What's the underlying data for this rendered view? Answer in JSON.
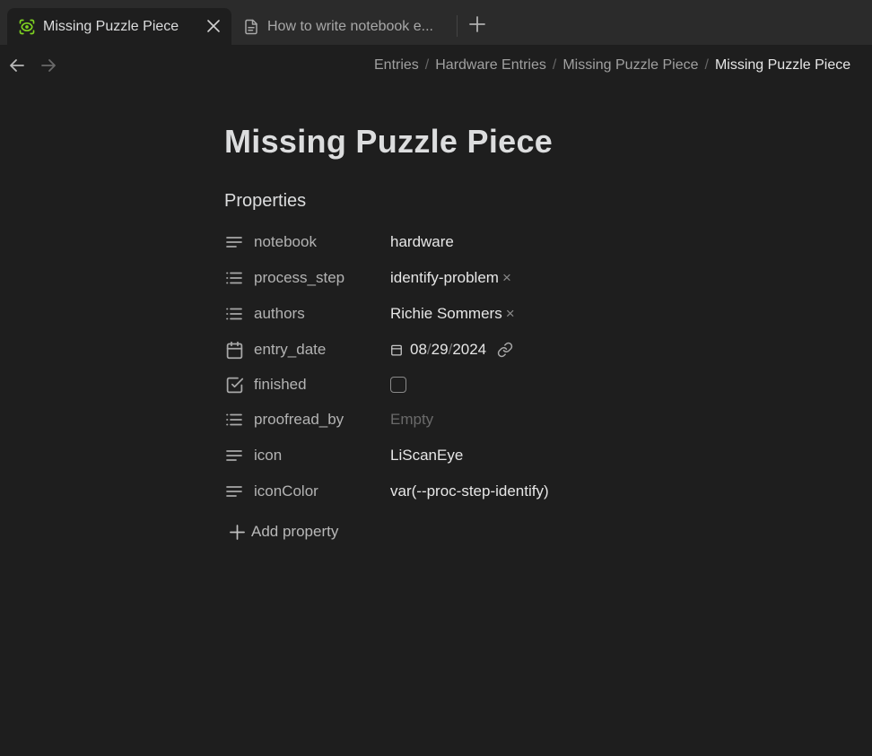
{
  "tabs": [
    {
      "title": "Missing Puzzle Piece",
      "active": true,
      "icon": "scan-eye-icon"
    },
    {
      "title": "How to write notebook e...",
      "active": false,
      "icon": "file-icon"
    }
  ],
  "breadcrumb": [
    "Entries",
    "Hardware Entries",
    "Missing Puzzle Piece",
    "Missing Puzzle Piece"
  ],
  "page": {
    "title": "Missing Puzzle Piece",
    "properties_heading": "Properties",
    "properties": [
      {
        "key": "notebook",
        "value": "hardware",
        "icon": "text-icon"
      },
      {
        "key": "process_step",
        "value": "identify-problem",
        "icon": "list-icon"
      },
      {
        "key": "authors",
        "value": "Richie Sommers",
        "icon": "list-icon"
      },
      {
        "key": "entry_date",
        "month": "08",
        "day": "29",
        "year": "2024",
        "icon": "calendar-icon"
      },
      {
        "key": "finished",
        "value": false,
        "icon": "checkbox-icon"
      },
      {
        "key": "proofread_by",
        "placeholder": "Empty",
        "icon": "list-icon"
      },
      {
        "key": "icon",
        "value": "LiScanEye",
        "icon": "text-icon"
      },
      {
        "key": "iconColor",
        "value": "var(--proc-step-identify)",
        "icon": "text-icon"
      }
    ],
    "add_property_label": "Add property"
  },
  "colors": {
    "background": "#1e1e1e",
    "tabbar": "#2b2b2b",
    "accent_green": "#7fd321"
  },
  "date_separator": "/",
  "remove_glyph": "×"
}
